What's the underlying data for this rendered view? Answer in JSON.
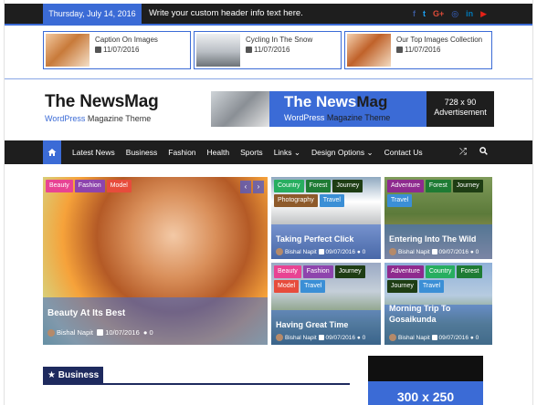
{
  "topbar": {
    "date": "Thursday, July 14, 2016",
    "header_text": "Write your custom header info text here.",
    "social": [
      {
        "icon": "facebook-icon",
        "glyph": "f",
        "color": "#3b5998"
      },
      {
        "icon": "twitter-icon",
        "glyph": "t",
        "color": "#1da1f2"
      },
      {
        "icon": "google-plus-icon",
        "glyph": "G+",
        "color": "#dd4b39"
      },
      {
        "icon": "instagram-icon",
        "glyph": "◎",
        "color": "#3b6bd6"
      },
      {
        "icon": "linkedin-icon",
        "glyph": "in",
        "color": "#0077b5"
      },
      {
        "icon": "youtube-icon",
        "glyph": "▶",
        "color": "#e62117"
      }
    ]
  },
  "featured": [
    {
      "title": "Caption On Images",
      "date": "11/07/2016"
    },
    {
      "title": "Cycling In The Snow",
      "date": "11/07/2016"
    },
    {
      "title": "Our Top Images Collection",
      "date": "11/07/2016"
    }
  ],
  "logo": {
    "name_part1": "The News",
    "name_part2": "Mag",
    "tagline_part1": "WordPress ",
    "tagline_part2": "Magazine Theme"
  },
  "banner": {
    "name_part1": "The News",
    "name_part2": "Mag",
    "tagline_part1": "WordPress ",
    "tagline_part2": "Magazine Theme",
    "size": "728 x 90",
    "label": "Advertisement"
  },
  "nav": {
    "items": [
      "Latest News",
      "Business",
      "Fashion",
      "Health",
      "Sports",
      "Links ⌄",
      "Design Options ⌄",
      "Contact Us"
    ]
  },
  "hero": {
    "main": {
      "tags": [
        {
          "label": "Beauty",
          "color": "#e84393"
        },
        {
          "label": "Fashion",
          "color": "#8e44ad"
        },
        {
          "label": "Model",
          "color": "#e74c3c"
        }
      ],
      "title": "Beauty At Its Best",
      "author": "Bishal Napit",
      "date": "10/07/2016",
      "comments": "0"
    },
    "tiles": [
      {
        "tags": [
          {
            "label": "Country",
            "color": "#27ae60"
          },
          {
            "label": "Forest",
            "color": "#1e7b34"
          },
          {
            "label": "Journey",
            "color": "#1e3d14"
          },
          {
            "label": "Photography",
            "color": "#8e5a2b"
          },
          {
            "label": "Travel",
            "color": "#3b8fd6"
          }
        ],
        "title": "Taking Perfect Click",
        "author": "Bishal Napit",
        "date": "09/07/2016",
        "comments": "0"
      },
      {
        "tags": [
          {
            "label": "Adventure",
            "color": "#8e2a8e"
          },
          {
            "label": "Forest",
            "color": "#1e7b34"
          },
          {
            "label": "Journey",
            "color": "#1e3d14"
          },
          {
            "label": "Travel",
            "color": "#3b8fd6"
          }
        ],
        "title": "Entering Into The Wild",
        "author": "Bishal Napit",
        "date": "09/07/2016",
        "comments": "0"
      },
      {
        "tags": [
          {
            "label": "Beauty",
            "color": "#e84393"
          },
          {
            "label": "Fashion",
            "color": "#8e44ad"
          },
          {
            "label": "Journey",
            "color": "#1e3d14"
          },
          {
            "label": "Model",
            "color": "#e74c3c"
          },
          {
            "label": "Travel",
            "color": "#3b8fd6"
          }
        ],
        "title": "Having Great Time",
        "author": "Bishal Napit",
        "date": "09/07/2016",
        "comments": "0"
      },
      {
        "tags": [
          {
            "label": "Adventure",
            "color": "#8e2a8e"
          },
          {
            "label": "Country",
            "color": "#27ae60"
          },
          {
            "label": "Forest",
            "color": "#1e7b34"
          },
          {
            "label": "Journey",
            "color": "#1e3d14"
          },
          {
            "label": "Travel",
            "color": "#3b8fd6"
          }
        ],
        "title": "Morning Trip To Gosaikunda",
        "author": "Bishal Napit",
        "date": "09/07/2016",
        "comments": "0"
      }
    ]
  },
  "business": {
    "label": "Business"
  },
  "ad": {
    "label": "300 x 250"
  },
  "colors": {
    "accent": "#3b6bd6",
    "dark": "#1e1e1e",
    "section": "#1e2a5e"
  }
}
